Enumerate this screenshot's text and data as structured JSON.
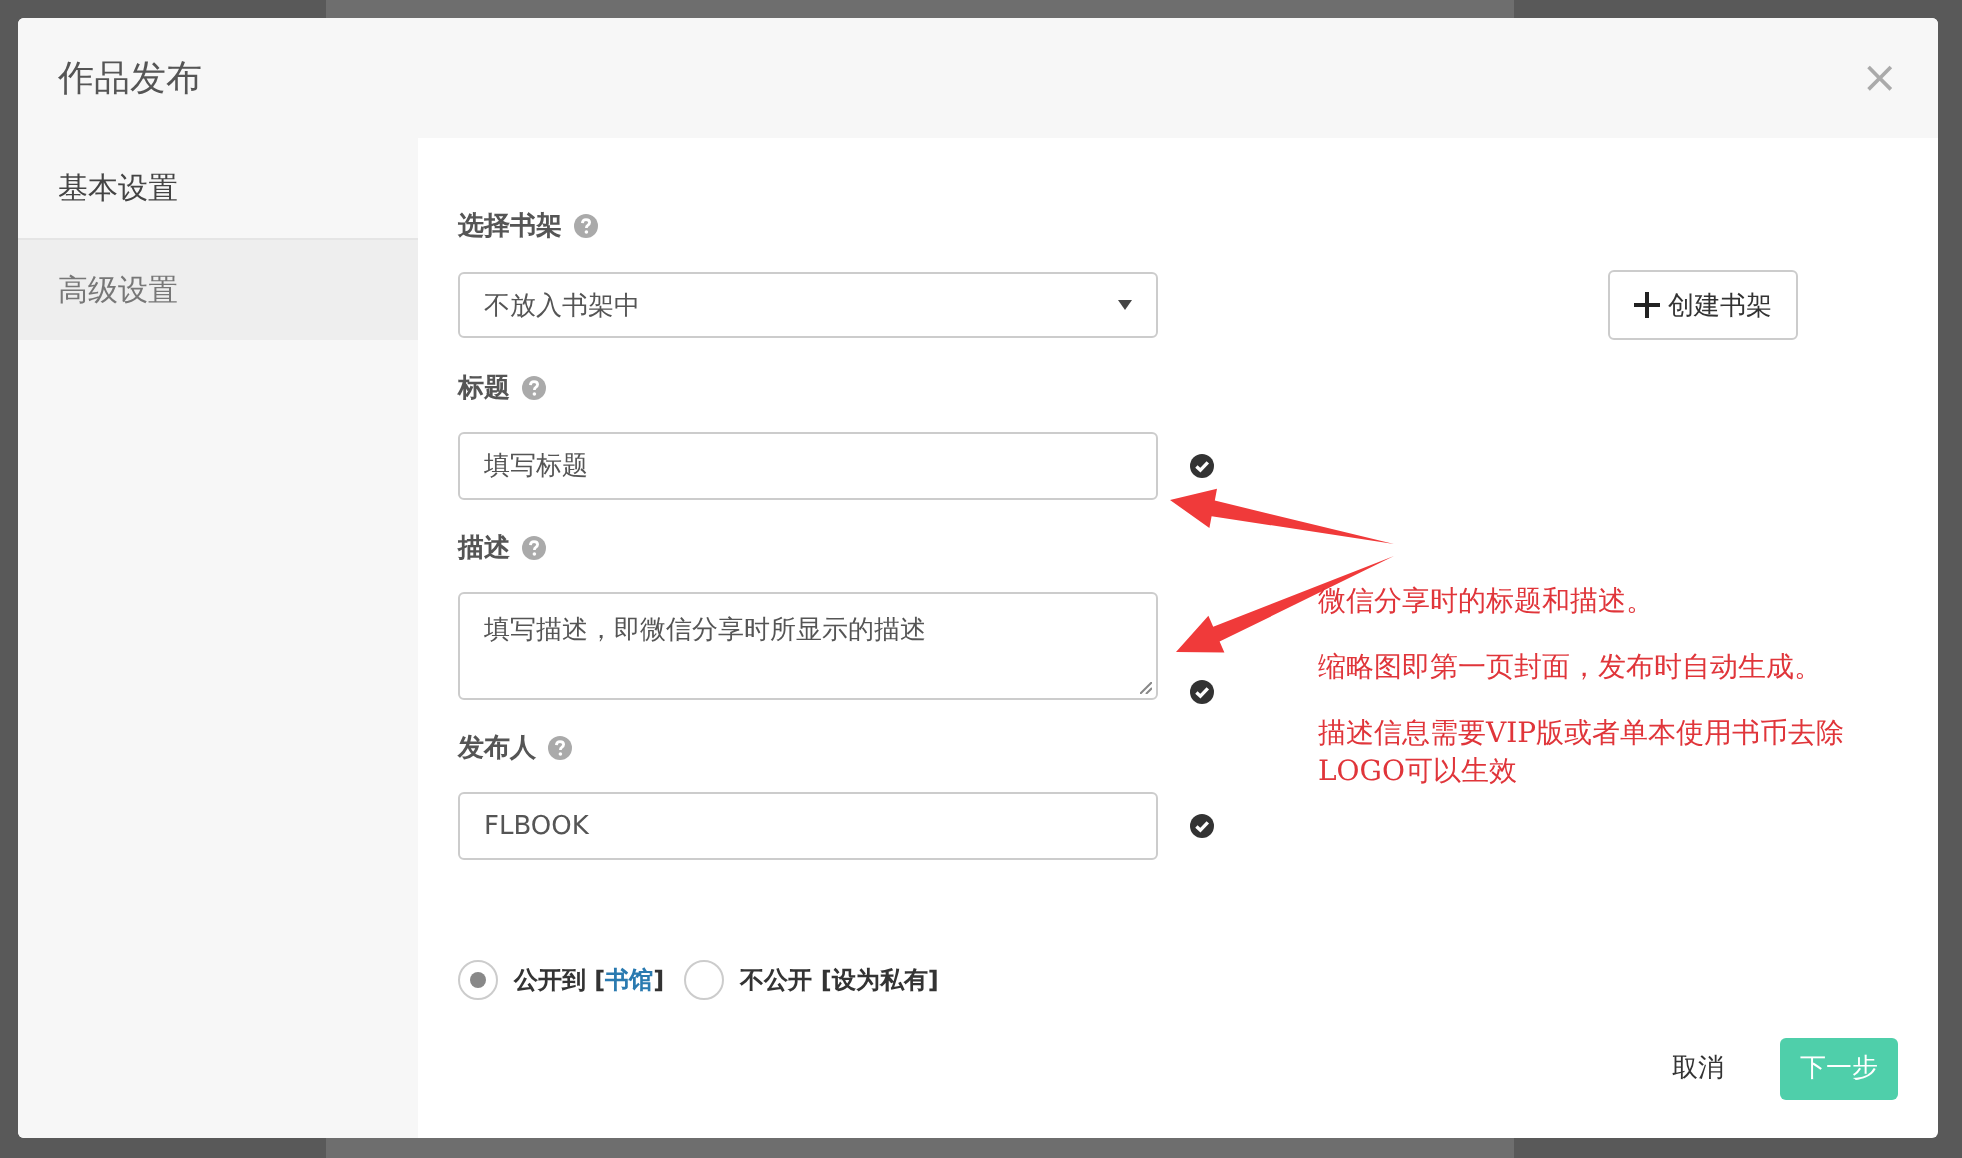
{
  "dialog": {
    "title": "作品发布",
    "close": "×",
    "tabs": [
      {
        "label": "基本设置",
        "selected": true
      },
      {
        "label": "高级设置",
        "selected": false
      }
    ],
    "fields": [
      {
        "kind": "select",
        "label": "选择书架",
        "value": "不放入书架中"
      },
      {
        "kind": "text",
        "label": "标题",
        "value": "填写标题",
        "validated": true
      },
      {
        "kind": "textarea",
        "label": "描述",
        "value": "填写描述，即微信分享时所显示的描述",
        "validated": true
      },
      {
        "kind": "text",
        "label": "发布人",
        "value": "FLBOOK",
        "validated": true
      }
    ],
    "create_button": "创建书架",
    "visibility": [
      {
        "prefix": "公开到 [",
        "link": "书馆",
        "suffix": "]",
        "selected": true
      },
      {
        "prefix": "不公开 [设为私有]",
        "selected": false
      }
    ],
    "cancel": "取消",
    "next": "下一步"
  },
  "annotations": [
    "微信分享时的标题和描述。",
    "缩略图即第一页封面，发布时自动生成。",
    "描述信息需要VIP版或者单本使用书币去除LOGO可以生效"
  ]
}
